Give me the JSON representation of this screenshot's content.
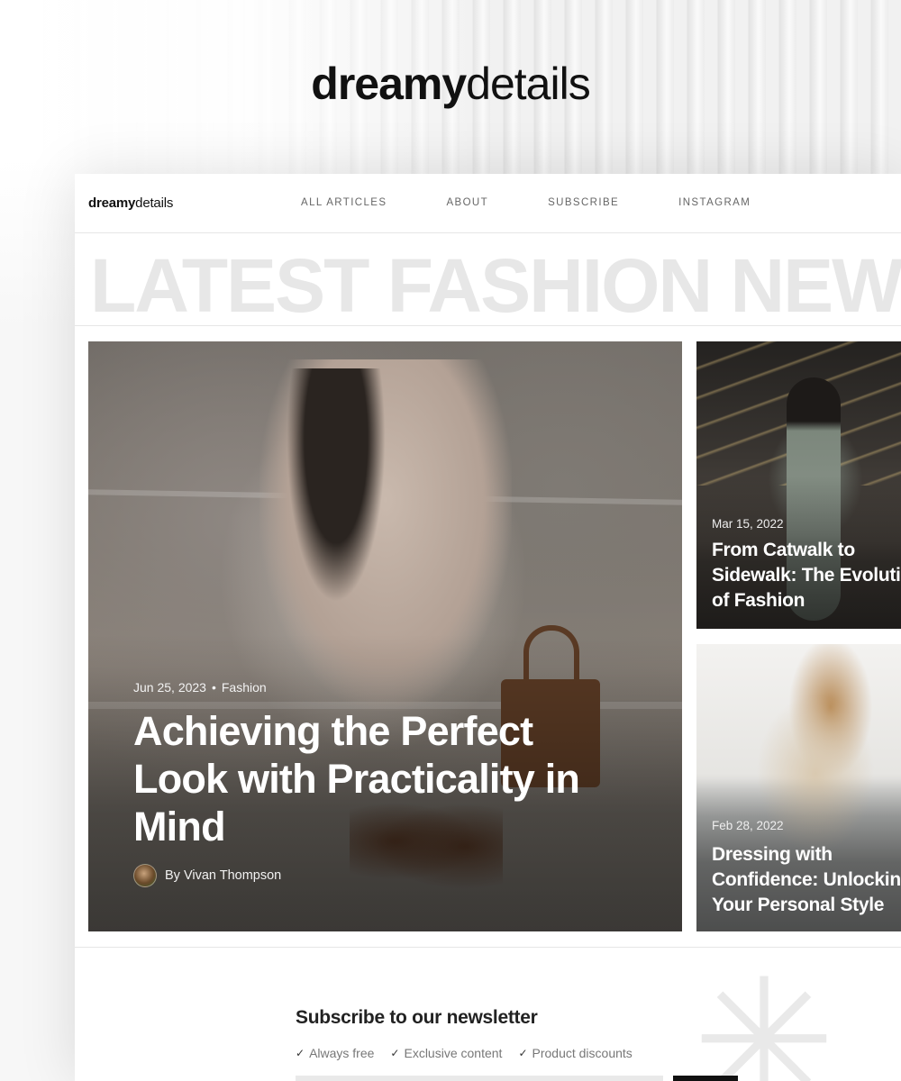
{
  "hero": {
    "logo_bold": "dreamy",
    "logo_light": "details"
  },
  "nav": {
    "logo_bold": "dreamy",
    "logo_light": "details",
    "links": [
      "ALL ARTICLES",
      "ABOUT",
      "SUBSCRIBE",
      "INSTAGRAM"
    ]
  },
  "banner": {
    "text": "LATEST FASHION NEWS"
  },
  "featured": {
    "date": "Jun 25, 2023",
    "category": "Fashion",
    "title": "Achieving the Perfect Look with Practicality in Mind",
    "author": "By Vivan Thompson"
  },
  "side_articles": [
    {
      "date": "Mar 15, 2022",
      "title": "From Catwalk to\nSidewalk: The Evolution\nof Fashion"
    },
    {
      "date": "Feb 28, 2022",
      "title": "Dressing with\nConfidence: Unlocking\nYour Personal Style"
    }
  ],
  "newsletter": {
    "title": "Subscribe to our newsletter",
    "perks": [
      "Always free",
      "Exclusive content",
      "Product discounts"
    ]
  },
  "colors": {
    "accent": "#111111",
    "banner_text": "#e7e7e7",
    "nav_link": "#666666"
  }
}
